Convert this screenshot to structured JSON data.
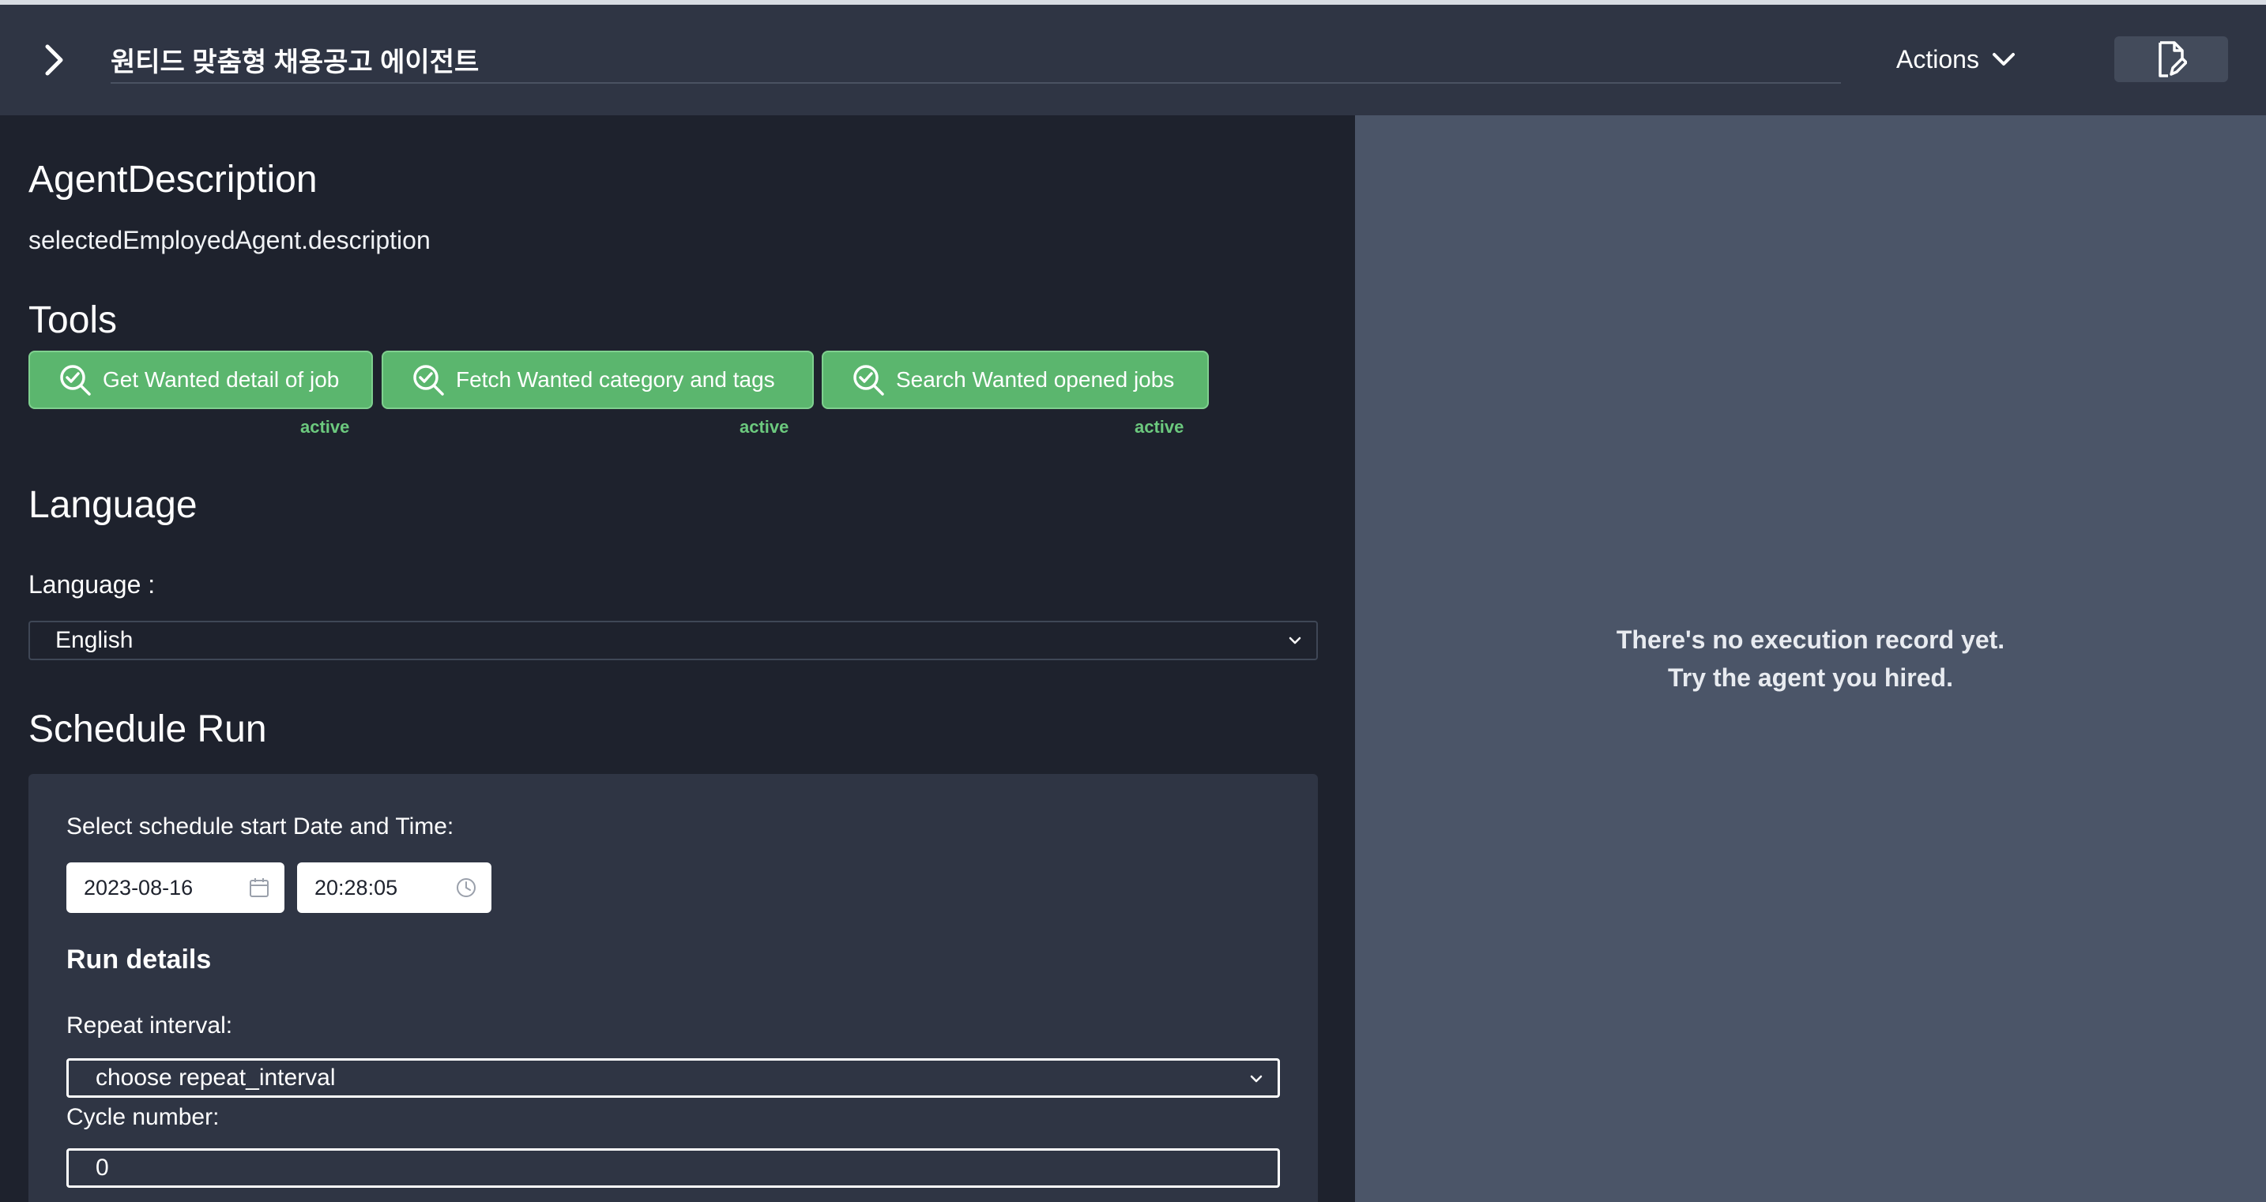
{
  "header": {
    "title": "원티드 맞춤형 채용공고 에이전트",
    "actions_label": "Actions"
  },
  "description": {
    "heading": "AgentDescription",
    "text": "selectedEmployedAgent.description"
  },
  "tools": {
    "heading": "Tools",
    "items": [
      {
        "label": "Get Wanted detail of job",
        "status": "active"
      },
      {
        "label": "Fetch Wanted category and tags",
        "status": "active"
      },
      {
        "label": "Search Wanted opened jobs",
        "status": "active"
      }
    ]
  },
  "language": {
    "heading": "Language",
    "label": "Language :",
    "selected": "English"
  },
  "schedule": {
    "heading": "Schedule Run",
    "start_label": "Select schedule start Date and Time:",
    "date": "2023-08-16",
    "time": "20:28:05",
    "run_details_heading": "Run details",
    "repeat_label": "Repeat interval:",
    "repeat_selected": "choose repeat_interval",
    "cycle_label": "Cycle number:",
    "cycle_value": "0"
  },
  "history": {
    "empty_line1": "There's no execution record yet.",
    "empty_line2": "Try the agent you hired."
  },
  "colors": {
    "header_bg": "#2f3544",
    "left_bg": "#1e222d",
    "right_bg": "#4b5568",
    "tool_green": "#5bb66e",
    "active_text": "#6cc97e"
  }
}
